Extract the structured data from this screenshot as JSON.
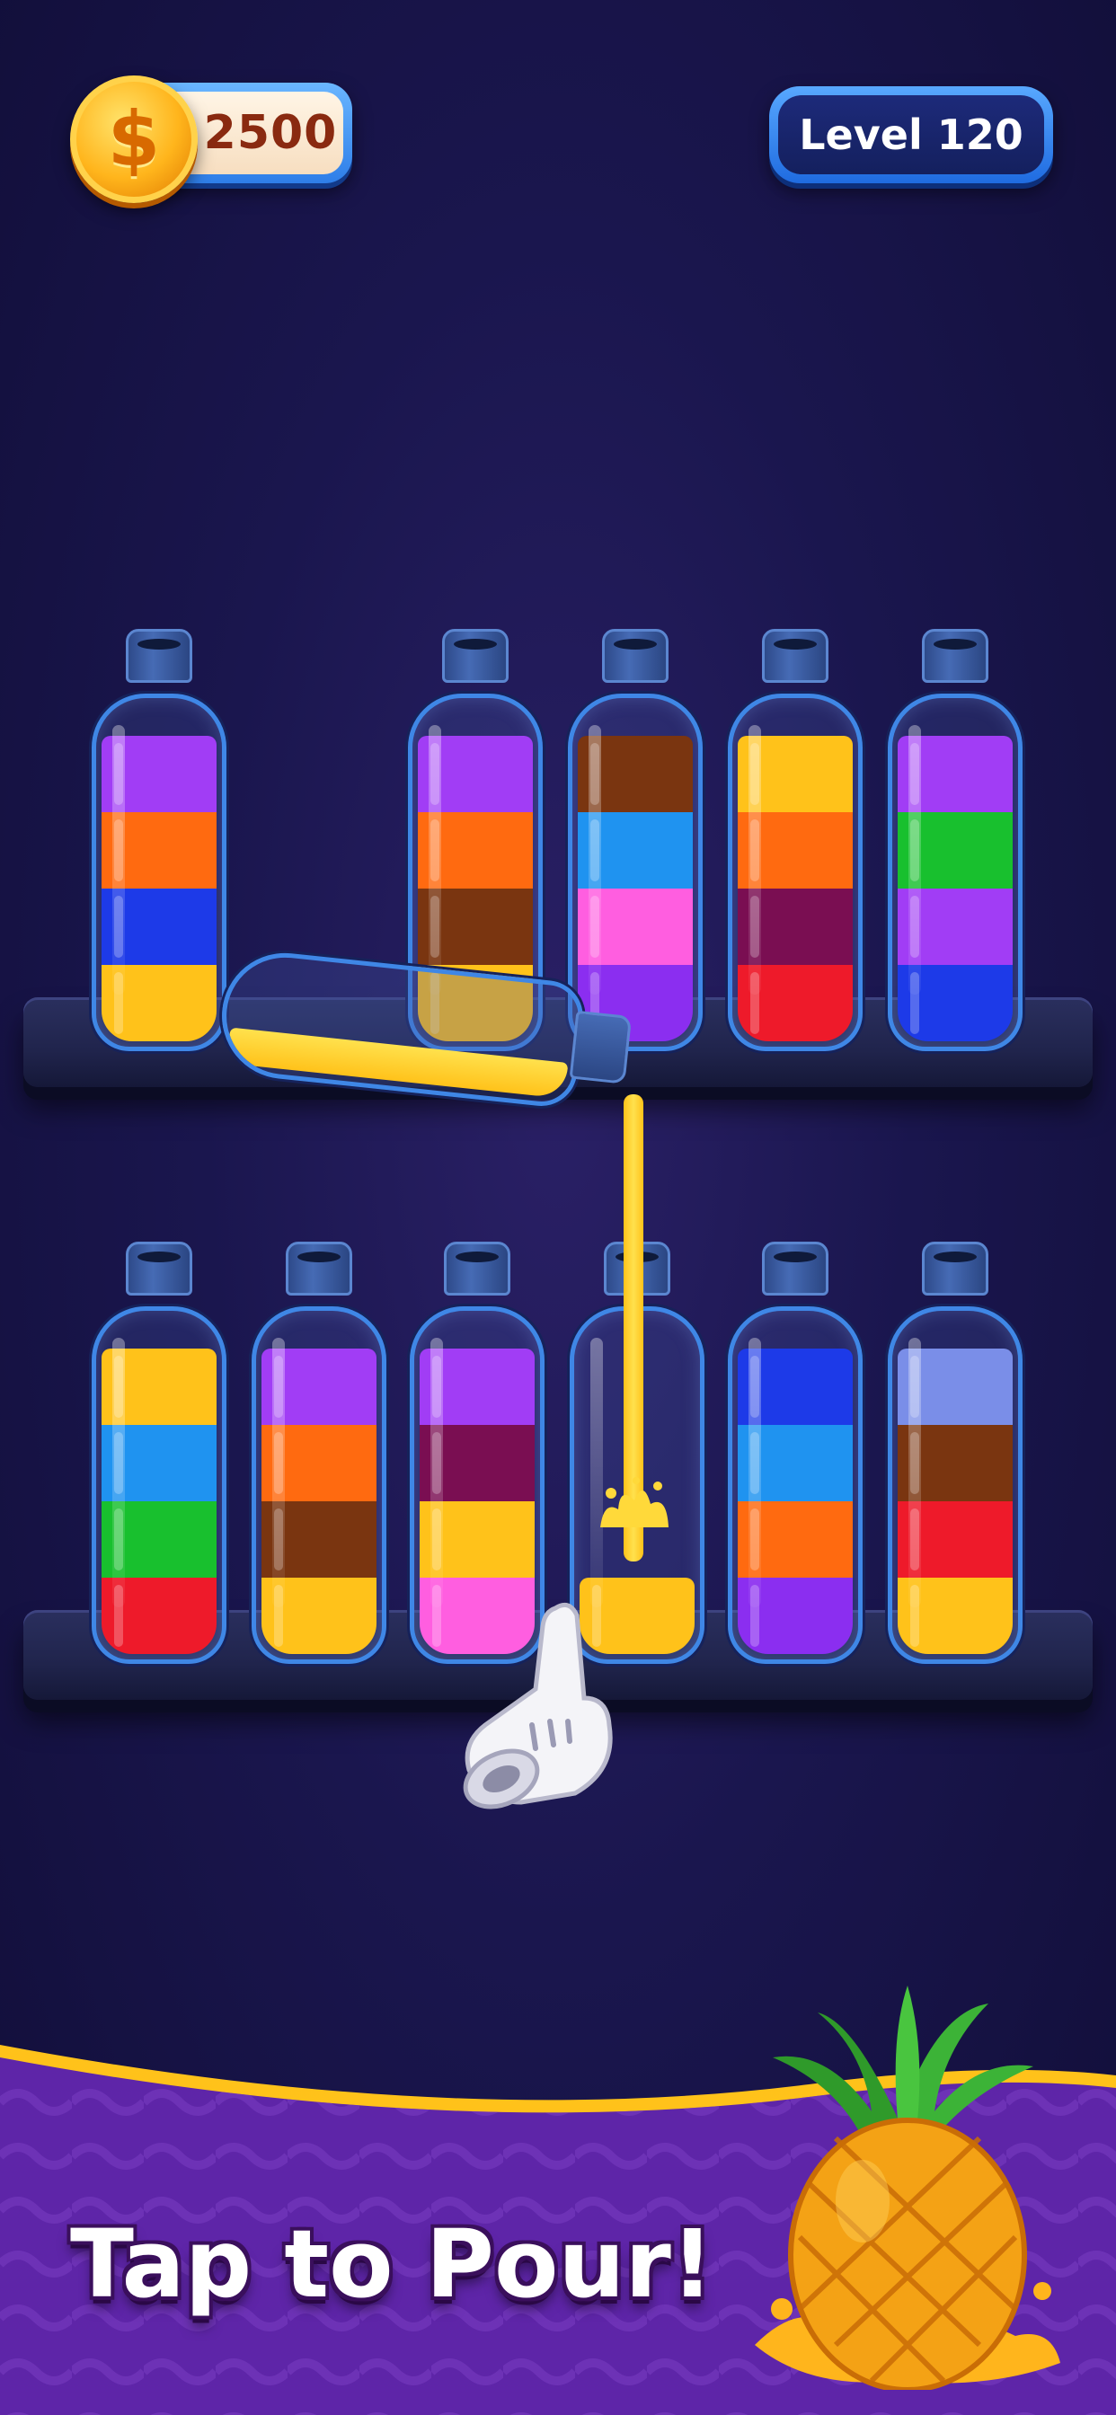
{
  "hud": {
    "coins": "2500",
    "level_label": "Level 120"
  },
  "colors": {
    "purple": "#a13df5",
    "orange": "#ff6a10",
    "blue": "#1d3ae8",
    "yellow": "#ffc21a",
    "brown": "#7a3510",
    "sky": "#1f93f0",
    "pink": "#ff5ee0",
    "maroon": "#7a0e52",
    "red": "#ee1a2a",
    "green": "#18c02e",
    "violet": "#8b2ef0",
    "periwinkle": "#7a8ee8"
  },
  "shelf_top": [
    {
      "id": "b1",
      "layers": [
        "yellow",
        "blue",
        "orange",
        "purple"
      ]
    },
    {
      "id": "b2",
      "layers": [
        "yellow",
        "brown",
        "orange",
        "purple"
      ]
    },
    {
      "id": "b3",
      "layers": [
        "violet",
        "pink",
        "sky",
        "brown"
      ]
    },
    {
      "id": "b4",
      "layers": [
        "red",
        "maroon",
        "orange",
        "yellow"
      ]
    },
    {
      "id": "b5",
      "layers": [
        "blue",
        "purple",
        "green",
        "purple"
      ]
    }
  ],
  "shelf_bottom": [
    {
      "id": "b6",
      "layers": [
        "red",
        "green",
        "sky",
        "yellow"
      ]
    },
    {
      "id": "b7",
      "layers": [
        "yellow",
        "brown",
        "orange",
        "purple"
      ]
    },
    {
      "id": "b8",
      "layers": [
        "pink",
        "yellow",
        "maroon",
        "purple"
      ]
    },
    {
      "id": "b9",
      "layers": [
        "yellow"
      ]
    },
    {
      "id": "b10",
      "layers": [
        "violet",
        "orange",
        "sky",
        "blue"
      ]
    },
    {
      "id": "b11",
      "layers": [
        "yellow",
        "red",
        "brown",
        "periwinkle"
      ]
    }
  ],
  "banner": {
    "cta": "Tap to Pour!"
  }
}
